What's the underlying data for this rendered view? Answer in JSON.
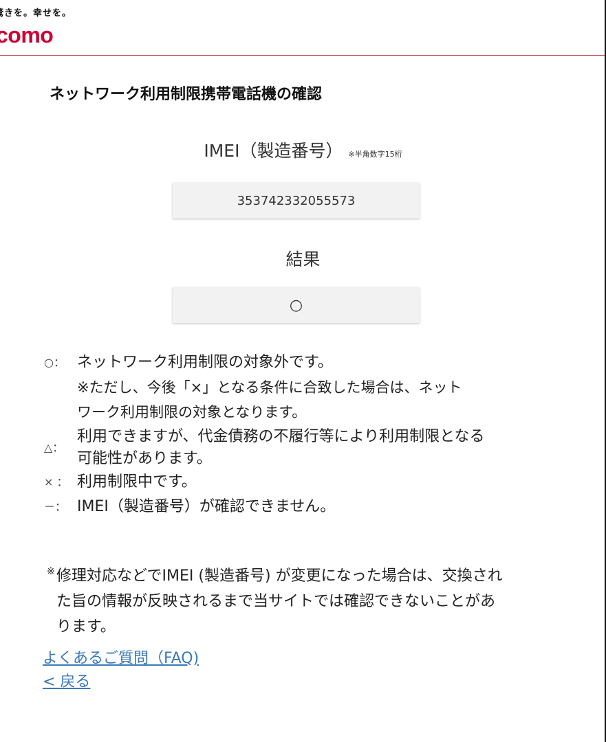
{
  "header": {
    "tagline": "驚きを。幸せを。",
    "logo": "como"
  },
  "page_title": "ネットワーク利用制限携帯電話機の確認",
  "imei": {
    "label": "IMEI（製造番号）",
    "note": "※半角数字15桁",
    "value": "353742332055573"
  },
  "result": {
    "label": "結果",
    "value": "○"
  },
  "legend": {
    "circle": {
      "symbol": "○：",
      "text": "ネットワーク利用制限の対象外です。",
      "sub_line1": "※ただし、今後「×」となる条件に合致した場合は、ネット",
      "sub_line2": "ワーク利用制限の対象となります。"
    },
    "triangle": {
      "symbol": "△：",
      "line1": "利用できますが、代金債務の不履行等により利用制限となる",
      "line2": "可能性があります。"
    },
    "cross": {
      "symbol": "×  ：",
      "text": "利用制限中です。"
    },
    "dash": {
      "symbol": "－：",
      "text": "IMEI（製造番号）が確認できません。"
    }
  },
  "note": {
    "mark": "※",
    "line1": "修理対応などでIMEI (製造番号) が変更になった場合は、交換され",
    "line2": "た旨の情報が反映されるまで当サイトでは確認できないことがあ",
    "line3": "ります。"
  },
  "links": {
    "faq": "よくあるご質問（FAQ)",
    "back": "< 戻る"
  },
  "colors": {
    "brand": "#cc0033",
    "link": "#3a78b8",
    "field_bg": "#f2f2f2"
  }
}
